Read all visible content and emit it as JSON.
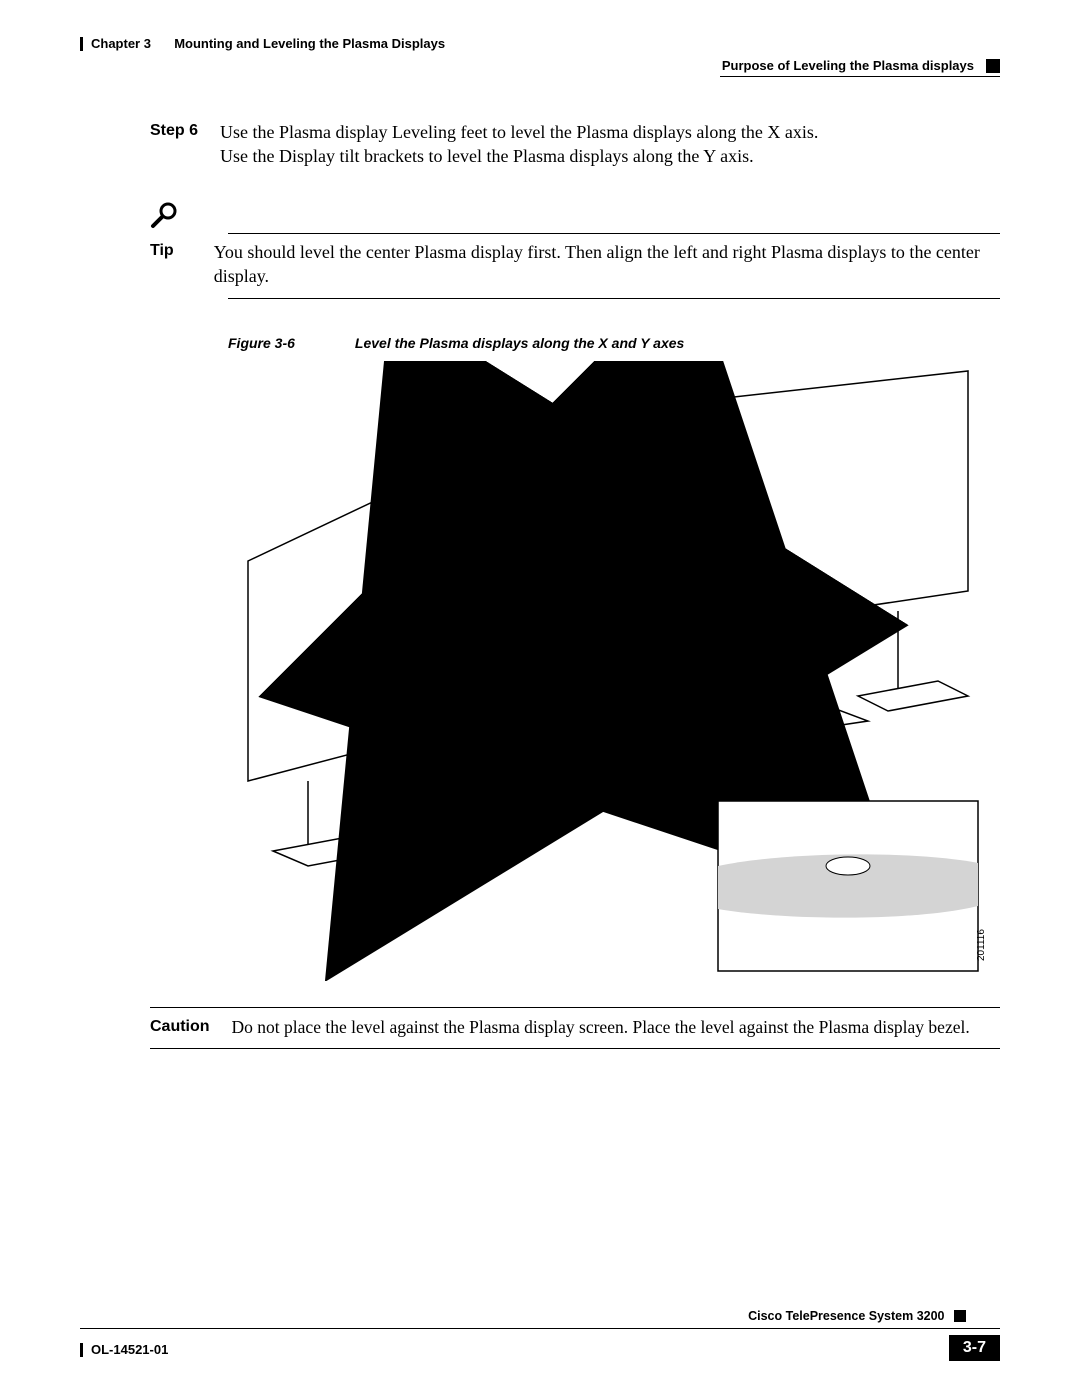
{
  "header": {
    "chapter_prefix": "Chapter 3",
    "chapter_title": "Mounting and Leveling the Plasma Displays",
    "section": "Purpose of Leveling the Plasma displays"
  },
  "step": {
    "label": "Step 6",
    "line1": "Use the Plasma display Leveling feet to level the Plasma displays along the X axis.",
    "line2": "Use the Display tilt brackets to level the Plasma displays along the Y axis."
  },
  "tip": {
    "label": "Tip",
    "text": "You should level the center Plasma display first. Then align the left and right Plasma displays to the center display."
  },
  "figure": {
    "ref": "Figure 3-6",
    "caption": "Level the Plasma displays along the X and Y axes",
    "callout_id": "201116"
  },
  "caution": {
    "label": "Caution",
    "text": "Do not place the level against the Plasma display screen. Place the level against the Plasma display bezel."
  },
  "footer": {
    "product": "Cisco TelePresence System 3200",
    "doc_id": "OL-14521-01",
    "page": "3-7"
  }
}
